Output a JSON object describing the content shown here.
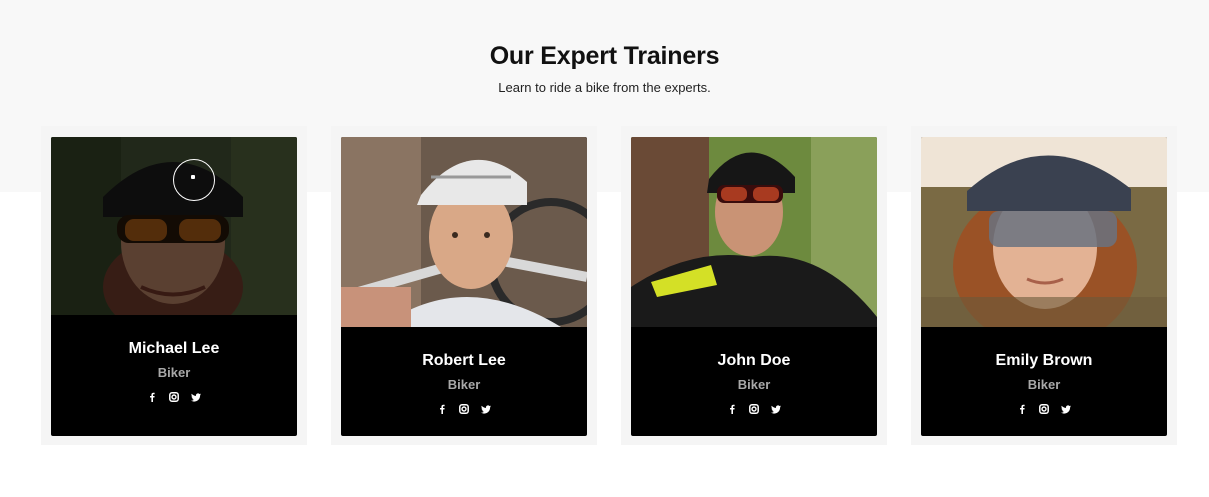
{
  "section": {
    "title": "Our Expert Trainers",
    "subtitle": "Learn to ride a bike from the experts."
  },
  "trainers": [
    {
      "name": "Michael Lee",
      "role": "Biker",
      "socials": [
        "facebook-icon",
        "instagram-icon",
        "twitter-icon"
      ]
    },
    {
      "name": "Robert Lee",
      "role": "Biker",
      "socials": [
        "facebook-icon",
        "instagram-icon",
        "twitter-icon"
      ]
    },
    {
      "name": "John Doe",
      "role": "Biker",
      "socials": [
        "facebook-icon",
        "instagram-icon",
        "twitter-icon"
      ]
    },
    {
      "name": "Emily Brown",
      "role": "Biker",
      "socials": [
        "facebook-icon",
        "instagram-icon",
        "twitter-icon"
      ]
    }
  ],
  "colors": {
    "band": "#f8f8f8",
    "card": "#000000",
    "name": "#ffffff",
    "role": "#a8a8a8"
  }
}
